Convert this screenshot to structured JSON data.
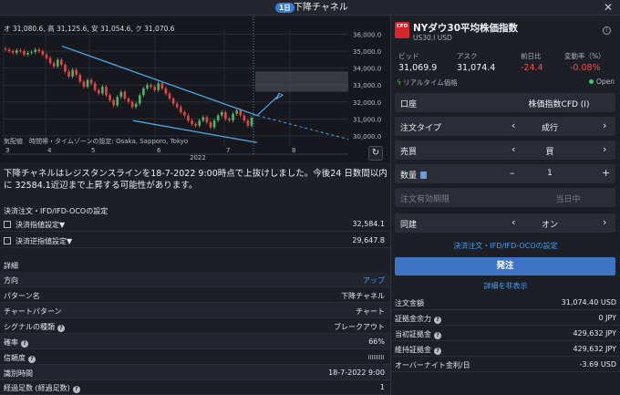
{
  "window": {
    "badge": "1日",
    "title": "下降チャネル",
    "close_icon": "close-icon"
  },
  "chart": {
    "ohlc": {
      "open_label": "オ",
      "open": "31,080.6",
      "high_label": "高",
      "high": "31,125.6",
      "low_label": "安",
      "low": "31,054.6",
      "close_label": "ク",
      "close": "31,070.6"
    },
    "note": "気配値　時間帯・タイムゾーンの設定: Osaka, Sapporo, Tokyo",
    "refresh_icon": "refresh-icon"
  },
  "chart_data": {
    "type": "candlestick",
    "y_ticks": [
      "36,000.0",
      "35,000.0",
      "34,000.0",
      "33,000.0",
      "32,000.0",
      "31,000.0",
      "30,000.0"
    ],
    "ylim": [
      29400,
      36300
    ],
    "x_ticks": [
      "3",
      "4",
      "5",
      "6",
      "7",
      "8"
    ],
    "year_label": "2022",
    "target_zone": [
      32600,
      33800
    ],
    "channel_upper": [
      [
        0,
        35300
      ],
      [
        1,
        31200
      ]
    ],
    "channel_lower": [
      [
        0,
        30900
      ],
      [
        1,
        29600
      ]
    ],
    "closes": [
      35100,
      35000,
      34900,
      35050,
      35000,
      34800,
      34900,
      34950,
      35100,
      35000,
      34800,
      34600,
      34300,
      34100,
      34500,
      34200,
      33800,
      33500,
      33900,
      33600,
      33200,
      32900,
      33300,
      33100,
      32700,
      32500,
      32900,
      32400,
      32100,
      31800,
      32300,
      32600,
      32200,
      32000,
      31700,
      31900,
      32400,
      32800,
      33000,
      32900,
      32700,
      33100,
      32800,
      32500,
      32200,
      31900,
      31700,
      31400,
      31200,
      30900,
      30700,
      30600,
      30900,
      31100,
      30800,
      30500,
      30900,
      31200,
      31400,
      31000,
      30900,
      31300,
      31500,
      31200,
      30900,
      30600,
      31070
    ]
  },
  "description": "下降チャネルはレジスタンスラインを18-7-2022 9:00時点で上抜けしました。今後24 日数間以内に 32584.1近辺まで上昇する可能性があります。",
  "order_section": {
    "title": "決済注文・IFD/IFD-OCOの設定",
    "rows": [
      {
        "label": "決済指値設定▼",
        "value": "32,584.1"
      },
      {
        "label": "決済逆指値設定▼",
        "value": "29,647.8"
      }
    ]
  },
  "details": {
    "title": "詳細",
    "rows": [
      {
        "label": "方向",
        "value": "アップ"
      },
      {
        "label": "パターン名",
        "value": "下降チャネル"
      },
      {
        "label": "チャートパターン",
        "value": "チャート"
      },
      {
        "label": "シグナルの種類",
        "value": "ブレークアウト"
      },
      {
        "label": "確率",
        "value": "66%"
      },
      {
        "label": "信頼度",
        "value": ""
      },
      {
        "label": "識別時間",
        "value": "18-7-2022 9:00"
      },
      {
        "label": "経過足数 (経過足数)",
        "value": "1"
      }
    ]
  },
  "instrument": {
    "icon_text": "CFD",
    "name": "NYダウ30平均株価指数",
    "code": "US30.I USD",
    "bid_label": "ビッド",
    "bid": "31,069.9",
    "ask_label": "アスク",
    "ask": "31,074.4",
    "change_label": "前日比",
    "change": "-24.4",
    "pct_label": "変動率（%）",
    "pct": "-0.08%",
    "realtime": "リアルタイム価格",
    "status": "Open"
  },
  "form": {
    "account_label": "口座",
    "account_value": "株価指数CFD (I)",
    "type_label": "注文タイプ",
    "type_value": "成行",
    "side_label": "売買",
    "side_value": "買",
    "qty_label": "数量",
    "qty_value": "1",
    "expiry_label": "注文有効期限",
    "expiry_value": "当日中",
    "linked_label": "同建",
    "linked_value": "オン",
    "settle_link": "決済注文・IFD/IFD-OCOの設定",
    "order_button": "発注",
    "hide_details": "詳細を非表示"
  },
  "summary": [
    {
      "label": "注文金額",
      "value": "31,074.40 USD"
    },
    {
      "label": "証拠金余力",
      "value": "0 JPY"
    },
    {
      "label": "当初証拠金",
      "value": "429,632 JPY"
    },
    {
      "label": "維持証拠金",
      "value": "429,632 JPY"
    },
    {
      "label": "オーバーナイト金利/日",
      "value": "-3.69 USD"
    }
  ]
}
